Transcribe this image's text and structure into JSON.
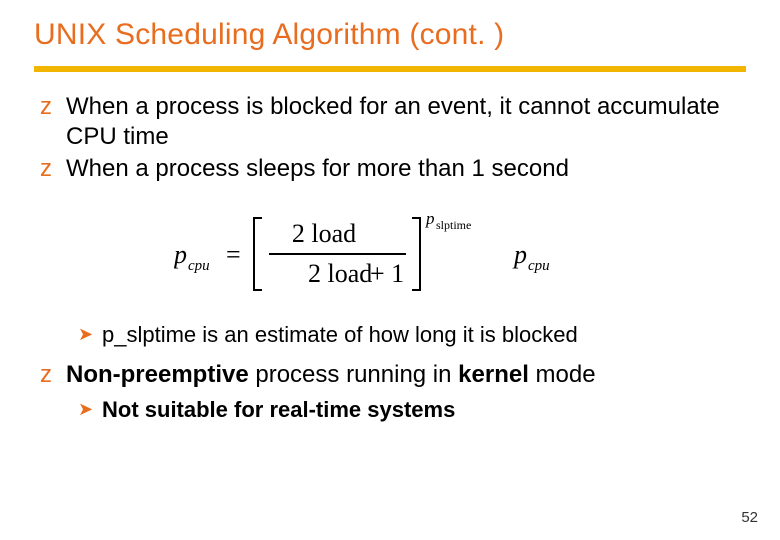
{
  "title": "UNIX Scheduling Algorithm (cont. )",
  "bullets": [
    "When a process is blocked for an event, it cannot accumulate CPU time",
    "When a process sleeps for more than 1 second"
  ],
  "formula": {
    "lhs": "p",
    "lhs_sub": "cpu",
    "eq": "=",
    "num_a": "2 load",
    "den_a": "2 load",
    "den_plus": "+ 1",
    "exp_p": "p",
    "exp_sub": "slptime",
    "rhs": "p",
    "rhs_sub": "cpu"
  },
  "sub1": "p_slptime is an estimate of how long it is blocked",
  "bullet3_a": "Non-preemptive",
  "bullet3_b": " process running in ",
  "bullet3_c": "kernel",
  "bullet3_d": " mode",
  "sub2": "Not suitable for real-time systems",
  "page": "52"
}
